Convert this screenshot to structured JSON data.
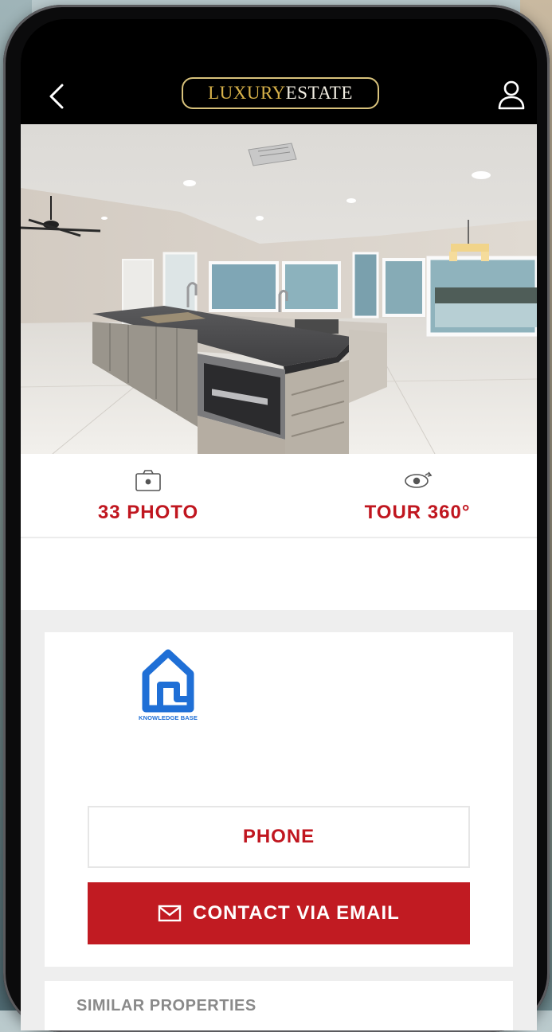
{
  "header": {
    "logo_word1": "LUXURY",
    "logo_word2": "ESTATE",
    "back_icon": "chevron-left-icon",
    "profile_icon": "user-icon"
  },
  "listing_photo": {
    "description_icon": "kitchen-photo"
  },
  "media_actions": [
    {
      "icon": "camera-icon",
      "label": "33 PHOTO"
    },
    {
      "icon": "eye-360-icon",
      "label": "TOUR 360°"
    }
  ],
  "agent": {
    "logo_icon": "house-logo-icon",
    "logo_text": "KNOWLEDGE BASE"
  },
  "contact": {
    "phone_label": "PHONE",
    "email_label": "CONTACT VIA EMAIL",
    "email_icon": "envelope-icon"
  },
  "similar": {
    "title": "SIMILAR PROPERTIES"
  },
  "colors": {
    "accent": "#c11b22",
    "logo_gold": "#d8b24a",
    "header_bg": "#000000",
    "section_bg": "#eeeeee"
  }
}
